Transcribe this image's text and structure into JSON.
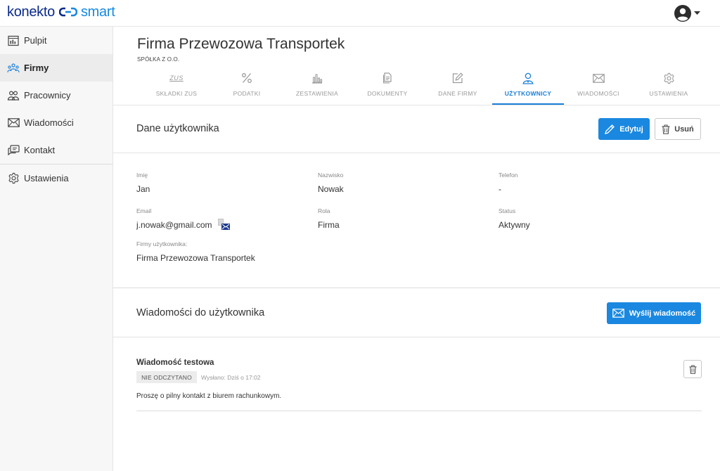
{
  "header": {
    "logo_part1": "konekto",
    "logo_part2": "smart"
  },
  "sidebar": {
    "items": [
      {
        "label": "Pulpit",
        "icon": "dashboard-icon"
      },
      {
        "label": "Firmy",
        "icon": "companies-icon",
        "active": true
      },
      {
        "label": "Pracownicy",
        "icon": "employees-icon"
      },
      {
        "label": "Wiadomości",
        "icon": "envelope-icon"
      },
      {
        "label": "Kontakt",
        "icon": "contact-icon"
      },
      {
        "label": "Ustawienia",
        "icon": "gear-icon"
      }
    ]
  },
  "company": {
    "name": "Firma Przewozowa Transportek",
    "type": "SPÓŁKA Z O.O."
  },
  "tabs": [
    {
      "label": "SKŁADKI ZUS",
      "icon_text": "ZUS"
    },
    {
      "label": "PODATKI"
    },
    {
      "label": "ZESTAWIENIA"
    },
    {
      "label": "DOKUMENTY"
    },
    {
      "label": "DANE FIRMY"
    },
    {
      "label": "UŻYTKOWNICY",
      "active": true
    },
    {
      "label": "WIADOMOŚCI"
    },
    {
      "label": "USTAWIENIA"
    }
  ],
  "user_section": {
    "title": "Dane użytkownika",
    "edit_label": "Edytuj",
    "delete_label": "Usuń",
    "fields": {
      "first_name": {
        "label": "Imię",
        "value": "Jan"
      },
      "last_name": {
        "label": "Nazwisko",
        "value": "Nowak"
      },
      "phone": {
        "label": "Telefon",
        "value": "-"
      },
      "email": {
        "label": "Email",
        "value": "j.nowak@gmail.com"
      },
      "role": {
        "label": "Rola",
        "value": "Firma"
      },
      "status": {
        "label": "Status",
        "value": "Aktywny"
      },
      "companies": {
        "label": "Firmy użytkownika:",
        "value": "Firma Przewozowa Transportek"
      }
    }
  },
  "messages_section": {
    "title": "Wiadomości do użytkownika",
    "send_label": "Wyślij wiadomość",
    "messages": [
      {
        "title": "Wiadomość testowa",
        "badge": "NIE ODCZYTANO",
        "sent": "Wysłano: Dziś o 17:02",
        "body": "Proszę o pilny kontakt z biurem rachunkowym."
      }
    ]
  },
  "colors": {
    "accent": "#1a88e0",
    "logo_dark": "#0a2a8a",
    "logo_light": "#1788e0"
  }
}
